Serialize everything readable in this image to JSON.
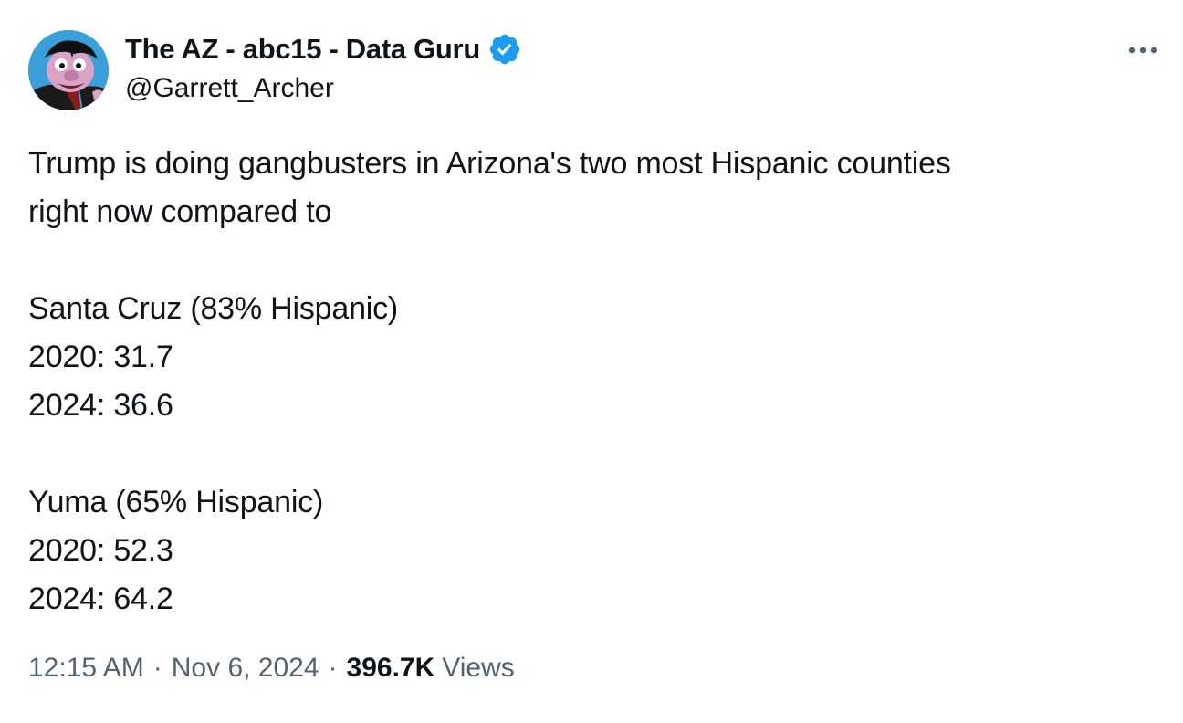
{
  "author": {
    "display_name": "The AZ - abc15 - Data Guru",
    "handle": "@Garrett_Archer",
    "verified_icon": "verified-badge-icon",
    "avatar_icon": "avatar-icon"
  },
  "more_icon": "more-icon",
  "tweet": {
    "lines": [
      "Trump is doing gangbusters in Arizona's two most Hispanic counties",
      "right now compared to",
      "",
      "Santa Cruz (83% Hispanic)",
      "2020: 31.7",
      "2024: 36.6",
      "",
      "Yuma (65% Hispanic)",
      "2020: 52.3",
      "2024: 64.2"
    ]
  },
  "meta": {
    "time": "12:15 AM",
    "separator": "·",
    "date": "Nov 6, 2024",
    "views_count": "396.7K",
    "views_label": "Views"
  },
  "colors": {
    "text_primary": "#0f1419",
    "text_secondary": "#536471",
    "verified_blue": "#1d9bf0"
  }
}
